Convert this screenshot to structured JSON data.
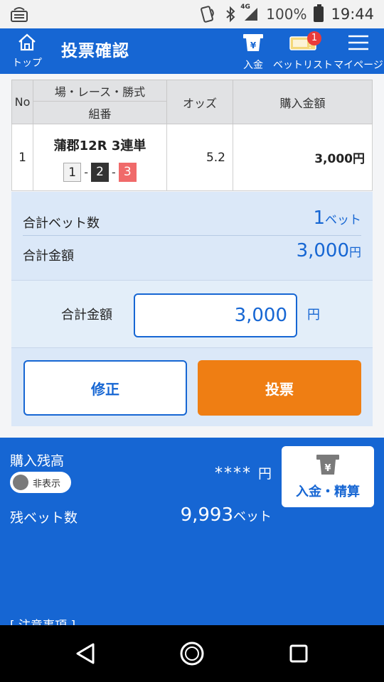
{
  "status_bar": {
    "network": "4G",
    "battery": "100%",
    "time": "19:44"
  },
  "header": {
    "home_label": "トップ",
    "title": "投票確認",
    "deposit_label": "入金",
    "betlist_label": "ベットリスト",
    "betlist_badge": "1",
    "mypage_label": "マイページ"
  },
  "table": {
    "headers": {
      "no": "No",
      "place": "場・レース・勝式",
      "combo": "組番",
      "odds": "オッズ",
      "amount": "購入金額"
    },
    "rows": [
      {
        "no": "1",
        "race": "蒲郡12R 3連単",
        "combo": [
          "1",
          "2",
          "3"
        ],
        "sep": "-",
        "odds": "5.2",
        "amount": "3,000円"
      }
    ]
  },
  "summary": {
    "bets_label": "合計ベット数",
    "bets_value": "1",
    "bets_unit": "ベット",
    "total_label": "合計金額",
    "total_value": "3,000",
    "total_unit": "円"
  },
  "input": {
    "label": "合計金額",
    "value": "3,000",
    "unit": "円"
  },
  "buttons": {
    "fix": "修正",
    "vote": "投票"
  },
  "balance": {
    "label": "購入残高",
    "toggle_label": "非表示",
    "value": "****",
    "value_unit": "円",
    "deposit_button": "入金・精算",
    "remain_label": "残ベット数",
    "remain_value": "9,993",
    "remain_unit": "ベット",
    "notice": "[ 注意事項 ]"
  },
  "colors": {
    "primary": "#1666d3",
    "vote": "#ef7e13",
    "badge": "#e83b3b"
  }
}
